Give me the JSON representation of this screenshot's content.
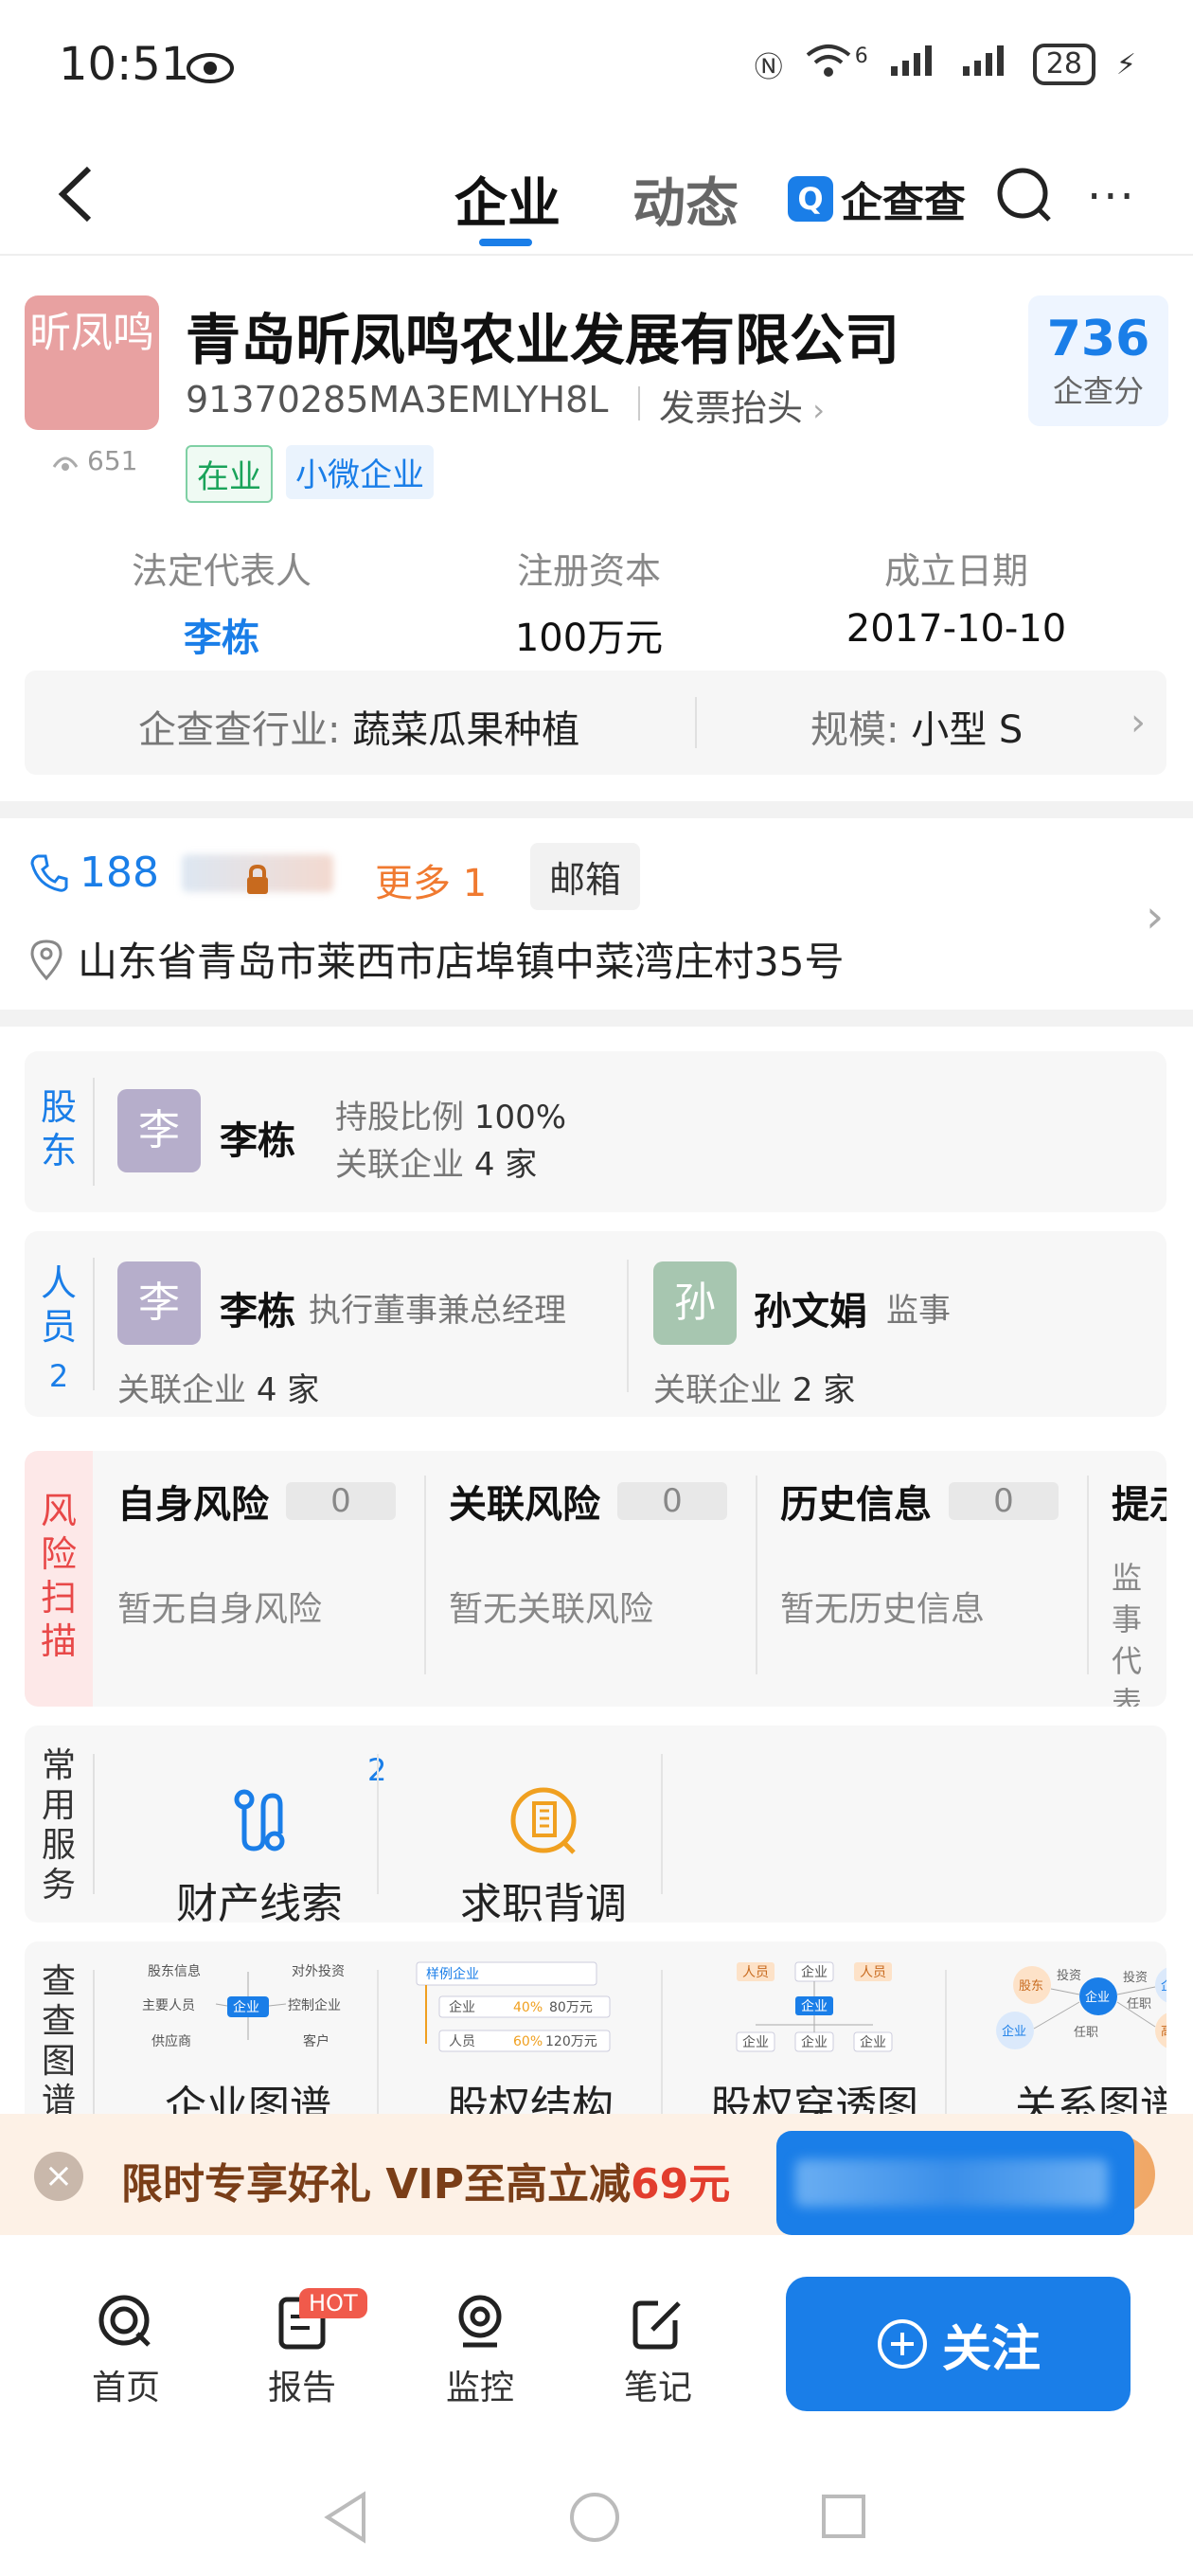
{
  "status_bar": {
    "time": "10:51",
    "network": "6",
    "battery": "28"
  },
  "nav": {
    "tab_company": "企业",
    "tab_news": "动态",
    "brand": "企查查",
    "brand_mark": "Q"
  },
  "company": {
    "logo_text": "昕凤鸣",
    "views": "651",
    "name": "青岛昕凤鸣农业发展有限公司",
    "credit_code": "91370285MA3EMLYH8L",
    "invoice_label": "发票抬头",
    "tags": [
      "在业",
      "小微企业"
    ],
    "score_value": "736",
    "score_label": "企查分",
    "legal_rep_label": "法定代表人",
    "legal_rep": "李栋",
    "capital_label": "注册资本",
    "capital": "100万元",
    "founded_label": "成立日期",
    "founded": "2017-10-10",
    "industry_label": "企查查行业:",
    "industry": "蔬菜瓜果种植",
    "scale_label": "规模:",
    "scale": "小型 S"
  },
  "contact": {
    "phone_prefix": "188",
    "more_label": "更多 1",
    "email_label": "邮箱",
    "address": "山东省青岛市莱西市店埠镇中菜湾庄村35号"
  },
  "shareholders": {
    "label": "股东",
    "name": "李栋",
    "avatar": "李",
    "ratio_label": "持股比例",
    "ratio": "100%",
    "related_label": "关联企业",
    "related": "4 家"
  },
  "staff": {
    "label": "人员",
    "count": "2",
    "people": [
      {
        "avatar": "李",
        "name": "李栋",
        "role": "执行董事兼总经理",
        "related_label": "关联企业",
        "related": "4 家"
      },
      {
        "avatar": "孙",
        "name": "孙文娟",
        "role": "监事",
        "related_label": "关联企业",
        "related": "2 家"
      }
    ]
  },
  "risk": {
    "label": "风险扫描",
    "items": [
      {
        "title": "自身风险",
        "count": "0",
        "desc": "暂无自身风险"
      },
      {
        "title": "关联风险",
        "count": "0",
        "desc": "暂无关联风险"
      },
      {
        "title": "历史信息",
        "count": "0",
        "desc": "暂无历史信息"
      },
      {
        "title": "提示",
        "desc": "监事 代表 息("
      }
    ]
  },
  "services": {
    "label": "常用服务",
    "items": [
      {
        "label": "财产线索",
        "badge": "2"
      },
      {
        "label": "求职背调"
      }
    ]
  },
  "graphs": {
    "label": "查查图谱",
    "items": [
      {
        "label": "企业图谱",
        "nodes": [
          "股东信息",
          "对外投资",
          "主要人员",
          "企业",
          "控制企业",
          "供应商",
          "客户"
        ]
      },
      {
        "label": "股权结构",
        "nodes": [
          "样例企业",
          "企业",
          "40%",
          "80万元",
          "人员",
          "60%",
          "120万元"
        ]
      },
      {
        "label": "股权穿透图",
        "nodes": [
          "人员",
          "企业",
          "人员",
          "企业",
          "企业",
          "企业",
          "企业"
        ]
      },
      {
        "label": "关系图谱",
        "nodes": [
          "股东",
          "投资",
          "企业",
          "投资",
          "企业",
          "任职",
          "高管",
          "任职",
          "企业"
        ]
      }
    ]
  },
  "promo": {
    "text": "限时专享好礼  VIP至高立减",
    "amount": "69元"
  },
  "bottom_nav": {
    "items": [
      "首页",
      "报告",
      "监控",
      "笔记"
    ],
    "hot_badge": "HOT",
    "follow": "关注"
  }
}
